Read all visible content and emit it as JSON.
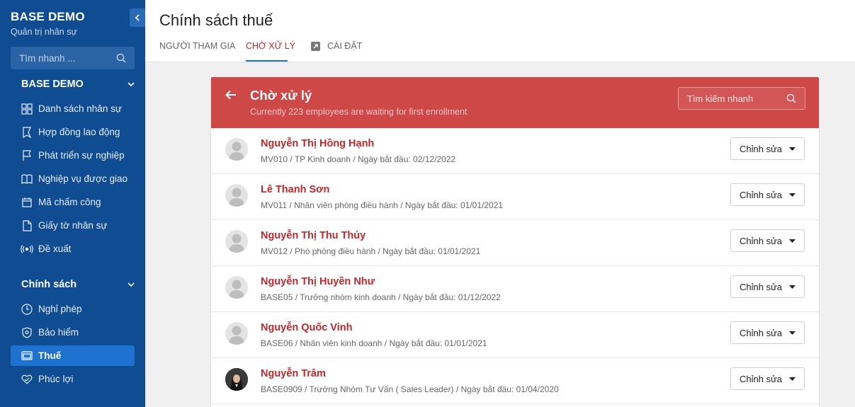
{
  "sidebar": {
    "brand_title": "BASE DEMO",
    "brand_subtitle": "Quản trị nhân sự",
    "search_placeholder": "Tìm nhanh ...",
    "section1": {
      "title": "BASE DEMO",
      "items": [
        {
          "label": "Danh sách nhân sự",
          "icon": "grid-icon"
        },
        {
          "label": "Hợp đồng lao động",
          "icon": "bookmark-icon"
        },
        {
          "label": "Phát triển sự nghiệp",
          "icon": "flag-icon"
        },
        {
          "label": "Nghiệp vụ được giao",
          "icon": "book-icon"
        },
        {
          "label": "Mã chấm công",
          "icon": "calendar-icon"
        },
        {
          "label": "Giấy tờ nhân sự",
          "icon": "document-icon"
        },
        {
          "label": "Đề xuất",
          "icon": "broadcast-icon"
        }
      ]
    },
    "section2": {
      "title": "Chính sách",
      "items": [
        {
          "label": "Nghỉ phép",
          "icon": "clock-icon"
        },
        {
          "label": "Bảo hiểm",
          "icon": "shield-icon"
        },
        {
          "label": "Thuế",
          "icon": "tax-card-icon",
          "active": true
        },
        {
          "label": "Phúc lợi",
          "icon": "heart-icon"
        }
      ]
    }
  },
  "header": {
    "title": "Chính sách thuế",
    "tabs": [
      {
        "label": "NGƯỜI THAM GIA"
      },
      {
        "label": "CHỜ XỬ LÝ",
        "active": true
      },
      {
        "label": "CÀI ĐẶT",
        "icon": "external-link-icon"
      }
    ]
  },
  "pending": {
    "title": "Chờ xử lý",
    "subtitle": "Currently 223 employees are waiting for first enrollment",
    "search_placeholder": "Tìm kiếm nhanh",
    "edit_label": "Chỉnh sửa",
    "employees": [
      {
        "name": "Nguyễn Thị Hồng Hạnh",
        "meta": "MV010 / TP Kinh doanh / Ngày bắt đầu: 02/12/2022",
        "avatar": "default"
      },
      {
        "name": "Lê Thanh Sơn",
        "meta": "MV011 / Nhân viên phòng điều hành / Ngày bắt đầu: 01/01/2021",
        "avatar": "default"
      },
      {
        "name": "Nguyễn Thị Thu Thủy",
        "meta": "MV012 / Phó phòng điều hành / Ngày bắt đầu: 01/01/2021",
        "avatar": "default"
      },
      {
        "name": "Nguyễn Thị Huyền Như",
        "meta": "BASE05 / Trưởng nhóm kinh doanh / Ngày bắt đầu: 01/12/2022",
        "avatar": "default"
      },
      {
        "name": "Nguyễn Quốc Vinh",
        "meta": "BASE06 / Nhân viên kinh doanh / Ngày bắt đầu: 01/01/2021",
        "avatar": "default"
      },
      {
        "name": "Nguyễn Trâm",
        "meta": "BASE0909 / Trưởng Nhóm Tư Vấn ( Sales Leader) / Ngày bắt đầu: 01/04/2020",
        "avatar": "photo"
      }
    ]
  }
}
